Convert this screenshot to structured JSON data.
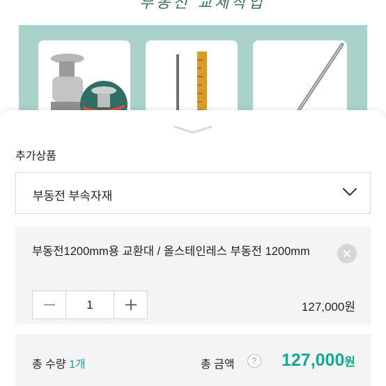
{
  "banner": {
    "heading": "부동전 교체작업",
    "icons": [
      "rotary-valve-image",
      "brass-ruler-image",
      "stainless-rod-image"
    ]
  },
  "sheet": {
    "section_title": "추가상품",
    "select": {
      "selected_value": "부동전 부속자재",
      "chevron_icon": "chevron-down-icon"
    },
    "option": {
      "name": "부동전1200mm용 교환대 / 올스테인레스 부동전 1200mm",
      "quantity": "1",
      "minus_icon": "minus-icon",
      "plus_icon": "plus-icon",
      "remove_icon": "close-icon",
      "price": "127,000원"
    },
    "summary": {
      "total_qty_label": "총 수량",
      "total_qty_value": "1개",
      "total_amount_label": "총 금액",
      "help_icon_text": "?",
      "total_amount_value": "127,000",
      "total_amount_unit": "원"
    }
  },
  "colors": {
    "accent": "#1aa691",
    "banner_panel": "#a9d3ca",
    "card_bg": "#f4f4f4"
  }
}
